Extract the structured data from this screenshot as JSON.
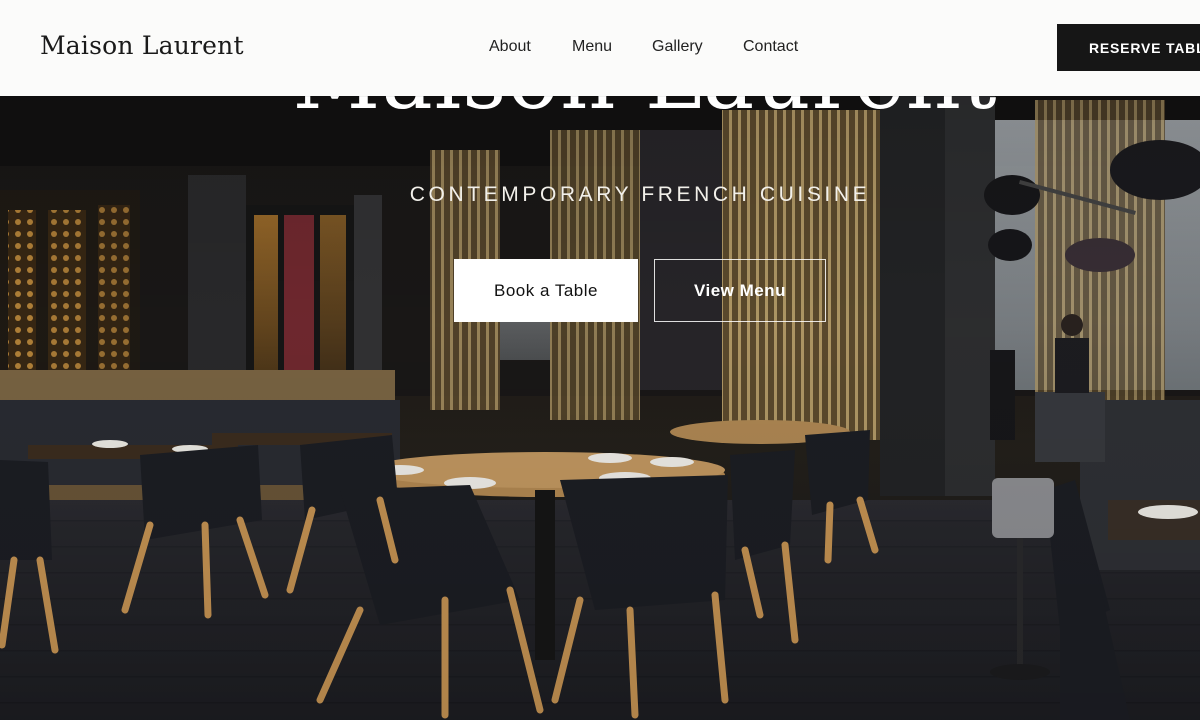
{
  "header": {
    "brand": "Maison Laurent",
    "nav": [
      "About",
      "Menu",
      "Gallery",
      "Contact"
    ],
    "cta_label": "RESERVE TABLE"
  },
  "hero": {
    "title": "Maison Laurent",
    "tagline": "CONTEMPORARY FRENCH CUISINE",
    "primary_button": "Book a Table",
    "secondary_button": "View Menu"
  },
  "colors": {
    "header_bg": "#fbfbfa",
    "cta_bg": "#161616",
    "primary_button_bg": "#ffffff",
    "hero_text": "#ffffff"
  },
  "icons": [
    "restaurant-interior-photo"
  ]
}
